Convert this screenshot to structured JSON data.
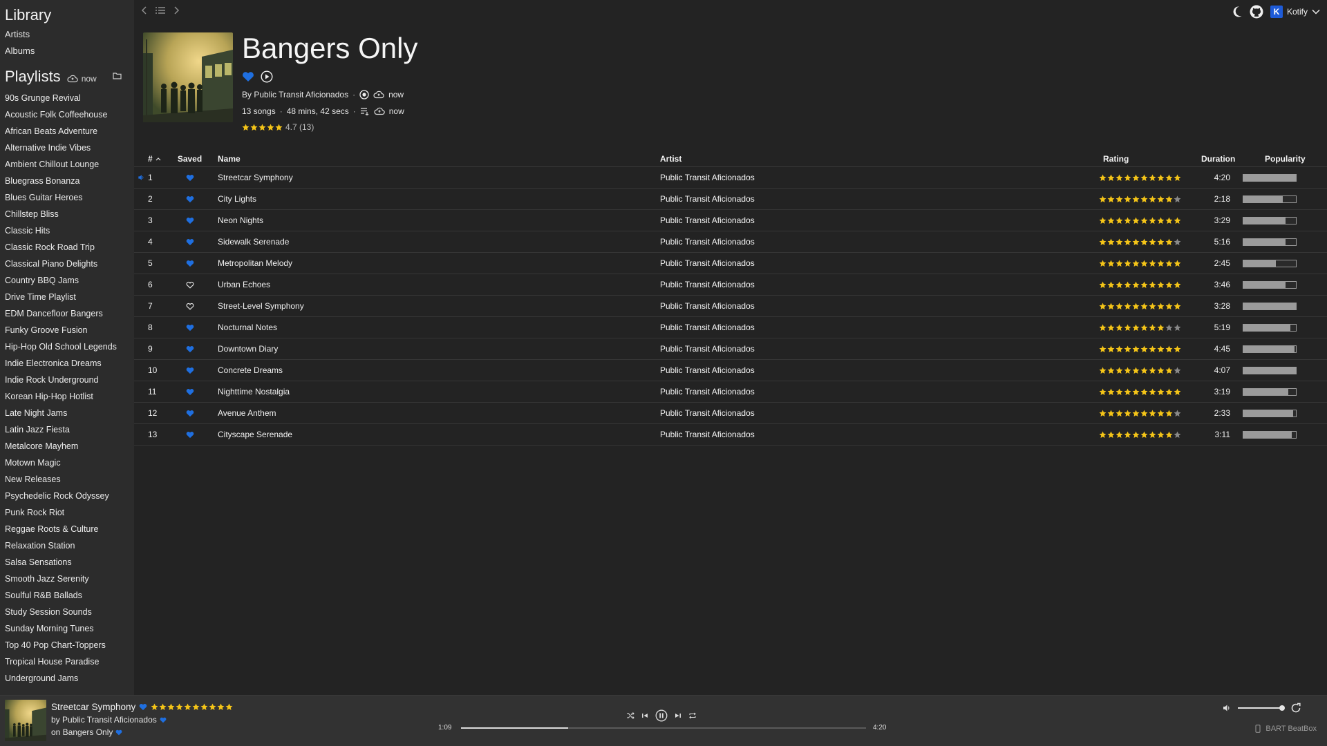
{
  "sidebar": {
    "library_title": "Library",
    "links": [
      "Artists",
      "Albums"
    ],
    "playlists_title": "Playlists",
    "playlists_sync": "now",
    "playlists": [
      "90s Grunge Revival",
      "Acoustic Folk Coffeehouse",
      "African Beats Adventure",
      "Alternative Indie Vibes",
      "Ambient Chillout Lounge",
      "Bluegrass Bonanza",
      "Blues Guitar Heroes",
      "Chillstep Bliss",
      "Classic Hits",
      "Classic Rock Road Trip",
      "Classical Piano Delights",
      "Country BBQ Jams",
      "Drive Time Playlist",
      "EDM Dancefloor Bangers",
      "Funky Groove Fusion",
      "Hip-Hop Old School Legends",
      "Indie Electronica Dreams",
      "Indie Rock Underground",
      "Korean Hip-Hop Hotlist",
      "Late Night Jams",
      "Latin Jazz Fiesta",
      "Metalcore Mayhem",
      "Motown Magic",
      "New Releases",
      "Psychedelic Rock Odyssey",
      "Punk Rock Riot",
      "Reggae Roots & Culture",
      "Relaxation Station",
      "Salsa Sensations",
      "Smooth Jazz Serenity",
      "Soulful R&B Ballads",
      "Study Session Sounds",
      "Sunday Morning Tunes",
      "Top 40 Pop Chart-Toppers",
      "Tropical House Paradise",
      "Underground Jams"
    ]
  },
  "topbar": {
    "user_initial": "K",
    "user_name": "Kotify"
  },
  "playlist": {
    "title": "Bangers Only",
    "by": "By Public Transit Aficionados",
    "sync1": "now",
    "songs": "13 songs",
    "length": "48 mins, 42 secs",
    "sync2": "now",
    "rating_text": "4.7 (13)",
    "rating_stars": 5
  },
  "table": {
    "headers": {
      "num": "#",
      "saved": "Saved",
      "name": "Name",
      "artist": "Artist",
      "rating": "Rating",
      "duration": "Duration",
      "popularity": "Popularity"
    },
    "rows": [
      {
        "num": "1",
        "saved": true,
        "name": "Streetcar Symphony",
        "artist": "Public Transit Aficionados",
        "rating": 10,
        "duration": "4:20",
        "popularity": 1.0,
        "playing": true
      },
      {
        "num": "2",
        "saved": true,
        "name": "City Lights",
        "artist": "Public Transit Aficionados",
        "rating": 9,
        "duration": "2:18",
        "popularity": 0.75
      },
      {
        "num": "3",
        "saved": true,
        "name": "Neon Nights",
        "artist": "Public Transit Aficionados",
        "rating": 10,
        "duration": "3:29",
        "popularity": 0.8
      },
      {
        "num": "4",
        "saved": true,
        "name": "Sidewalk Serenade",
        "artist": "Public Transit Aficionados",
        "rating": 9,
        "duration": "5:16",
        "popularity": 0.8
      },
      {
        "num": "5",
        "saved": true,
        "name": "Metropolitan Melody",
        "artist": "Public Transit Aficionados",
        "rating": 10,
        "duration": "2:45",
        "popularity": 0.62
      },
      {
        "num": "6",
        "saved": false,
        "name": "Urban Echoes",
        "artist": "Public Transit Aficionados",
        "rating": 10,
        "duration": "3:46",
        "popularity": 0.8
      },
      {
        "num": "7",
        "saved": false,
        "name": "Street-Level Symphony",
        "artist": "Public Transit Aficionados",
        "rating": 10,
        "duration": "3:28",
        "popularity": 1.0
      },
      {
        "num": "8",
        "saved": true,
        "name": "Nocturnal Notes",
        "artist": "Public Transit Aficionados",
        "rating": 8,
        "duration": "5:19",
        "popularity": 0.9
      },
      {
        "num": "9",
        "saved": true,
        "name": "Downtown Diary",
        "artist": "Public Transit Aficionados",
        "rating": 10,
        "duration": "4:45",
        "popularity": 0.98
      },
      {
        "num": "10",
        "saved": true,
        "name": "Concrete Dreams",
        "artist": "Public Transit Aficionados",
        "rating": 9,
        "duration": "4:07",
        "popularity": 1.0
      },
      {
        "num": "11",
        "saved": true,
        "name": "Nighttime Nostalgia",
        "artist": "Public Transit Aficionados",
        "rating": 10,
        "duration": "3:19",
        "popularity": 0.85
      },
      {
        "num": "12",
        "saved": true,
        "name": "Avenue Anthem",
        "artist": "Public Transit Aficionados",
        "rating": 9,
        "duration": "2:33",
        "popularity": 0.95
      },
      {
        "num": "13",
        "saved": true,
        "name": "Cityscape Serenade",
        "artist": "Public Transit Aficionados",
        "rating": 9,
        "duration": "3:11",
        "popularity": 0.92
      }
    ]
  },
  "player": {
    "title": "Streetcar Symphony",
    "artist_line": "by Public Transit Aficionados",
    "playlist_line": "on Bangers Only",
    "rating": 10,
    "current": "1:09",
    "total": "4:20",
    "progress": 0.265,
    "volume": 1.0,
    "device": "BART BeatBox"
  },
  "colors": {
    "accent": "#1f6fe0",
    "star": "#f5c518",
    "star_empty": "#8a8a8a",
    "bg": "#232323",
    "sidebar": "#2c2c2c"
  }
}
